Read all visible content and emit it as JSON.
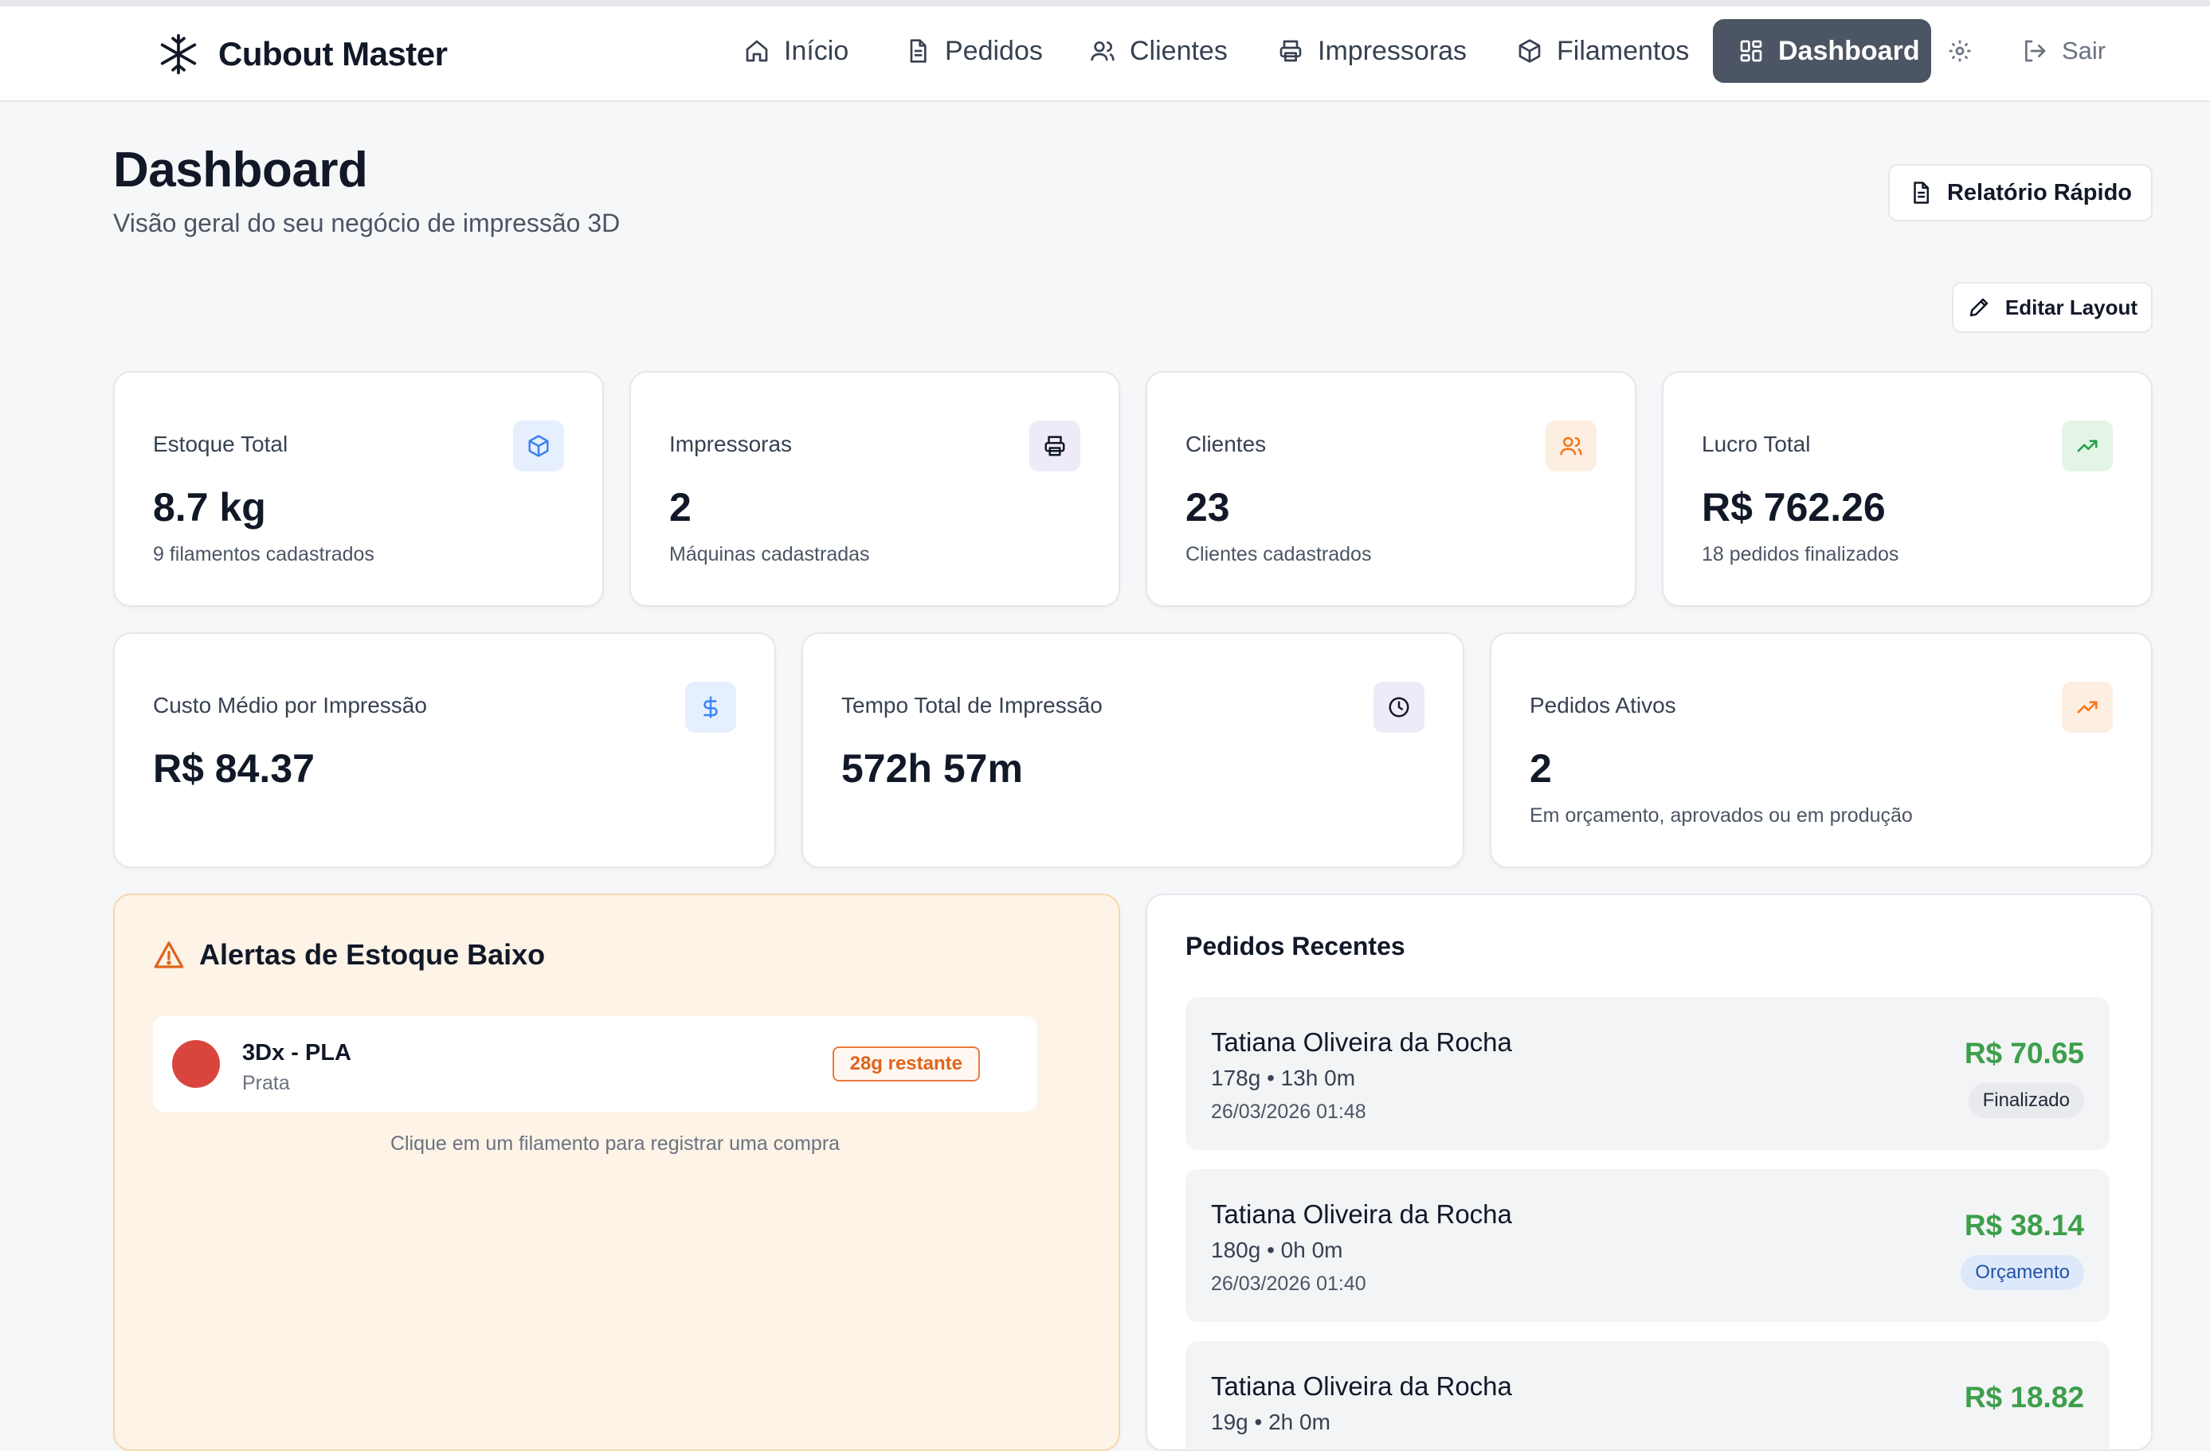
{
  "nav": {
    "brand": "Cubout Master",
    "items": [
      {
        "label": "Início",
        "icon": "home-icon"
      },
      {
        "label": "Pedidos",
        "icon": "document-icon"
      },
      {
        "label": "Clientes",
        "icon": "users-icon"
      },
      {
        "label": "Impressoras",
        "icon": "printer-icon"
      },
      {
        "label": "Filamentos",
        "icon": "box-icon"
      },
      {
        "label": "Dashboard",
        "icon": "grid-icon",
        "active": true
      }
    ],
    "logout": "Sair"
  },
  "header": {
    "title": "Dashboard",
    "subtitle": "Visão geral do seu negócio de impressão 3D",
    "report_button": "Relatório Rápido",
    "edit_layout_button": "Editar Layout"
  },
  "stats": [
    {
      "label": "Estoque Total",
      "value": "8.7 kg",
      "sub": "9 filamentos cadastrados",
      "icon": "box-icon",
      "color": "#3b82f6"
    },
    {
      "label": "Impressoras",
      "value": "2",
      "sub": "Máquinas cadastradas",
      "icon": "printer-icon",
      "color": "#111827"
    },
    {
      "label": "Clientes",
      "value": "23",
      "sub": "Clientes cadastrados",
      "icon": "users-icon",
      "color": "#f97316"
    },
    {
      "label": "Lucro Total",
      "value": "R$ 762.26",
      "sub": "18 pedidos finalizados",
      "icon": "trending-up-icon",
      "color": "#22a046"
    }
  ],
  "stats2": [
    {
      "label": "Custo Médio por Impressão",
      "value": "R$ 84.37",
      "sub": "",
      "icon": "dollar-icon",
      "color": "#3b82f6"
    },
    {
      "label": "Tempo Total de Impressão",
      "value": "572h 57m",
      "sub": "",
      "icon": "clock-icon",
      "color": "#111827"
    },
    {
      "label": "Pedidos Ativos",
      "value": "2",
      "sub": "Em orçamento, aprovados ou em produção",
      "icon": "trending-up-icon",
      "color": "#f97316"
    }
  ],
  "alerts": {
    "title": "Alertas de Estoque Baixo",
    "items": [
      {
        "name": "3Dx - PLA",
        "color_name": "Prata",
        "remaining": "28g restante",
        "swatch": "#d9453d"
      }
    ],
    "hint": "Clique em um filamento para registrar uma compra"
  },
  "recent": {
    "title": "Pedidos Recentes",
    "orders": [
      {
        "client": "Tatiana Oliveira da Rocha",
        "meta": "178g • 13h 0m",
        "date": "26/03/2026 01:48",
        "price": "R$ 70.65",
        "status": "Finalizado"
      },
      {
        "client": "Tatiana Oliveira da Rocha",
        "meta": "180g • 0h 0m",
        "date": "26/03/2026 01:40",
        "price": "R$ 38.14",
        "status": "Orçamento"
      },
      {
        "client": "Tatiana Oliveira da Rocha",
        "meta": "19g • 2h 0m",
        "date": "",
        "price": "R$ 18.82",
        "status": ""
      }
    ]
  }
}
